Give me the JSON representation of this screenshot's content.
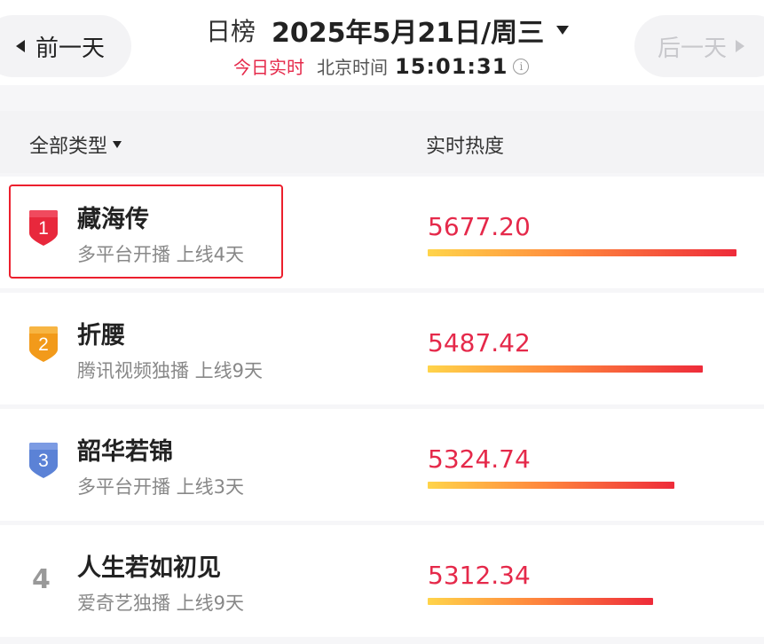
{
  "header": {
    "prev_label": "前一天",
    "next_label": "后一天",
    "ranking_label": "日榜",
    "date": "2025年5月21日/周三",
    "live_label": "今日实时",
    "timezone_label": "北京时间",
    "time": "15:01:31",
    "info_icon_glyph": "i"
  },
  "list_header": {
    "filter_label": "全部类型",
    "heat_label": "实时热度"
  },
  "rows": [
    {
      "rank": "1",
      "title": "藏海传",
      "meta": "多平台开播 上线4天",
      "heat": "5677.20",
      "heat_fraction": 1.0,
      "badge_color": "#e8283c",
      "badge_color_light": "#f04a5e",
      "highlighted": true
    },
    {
      "rank": "2",
      "title": "折腰",
      "meta": "腾讯视频独播 上线9天",
      "heat": "5487.42",
      "heat_fraction": 0.89,
      "badge_color": "#f29a1a",
      "badge_color_light": "#f7b543"
    },
    {
      "rank": "3",
      "title": "韶华若锦",
      "meta": "多平台开播 上线3天",
      "heat": "5324.74",
      "heat_fraction": 0.8,
      "badge_color": "#5b82d6",
      "badge_color_light": "#7c9be3"
    },
    {
      "rank": "4",
      "title": "人生若如初见",
      "meta": "爱奇艺独播 上线9天",
      "heat": "5312.34",
      "heat_fraction": 0.73
    }
  ],
  "colors": {
    "accent": "#e5294a",
    "highlight_border": "#ec1f2d"
  }
}
